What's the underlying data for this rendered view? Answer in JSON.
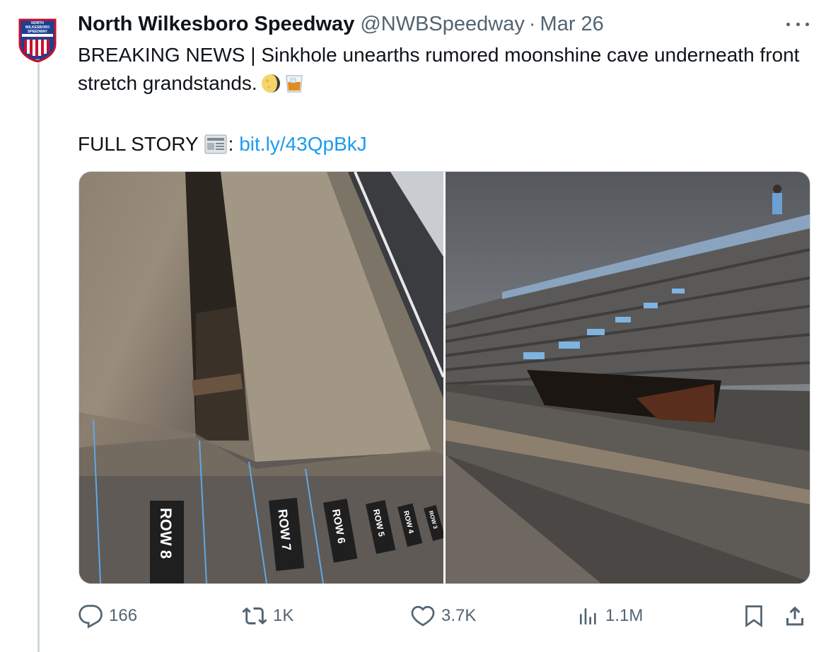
{
  "tweet": {
    "author_name": "North Wilkesboro Speedway",
    "handle": "@NWBSpeedway",
    "separator": "·",
    "date": "Mar 26",
    "text_line1": "BREAKING NEWS | Sinkhole unearths rumored moonshine cave underneath front stretch grandstands.",
    "story_label": "FULL STORY",
    "story_colon": ":",
    "link_text": "bit.ly/43QpBkJ",
    "logo": {
      "line1": "NORTH",
      "line2": "WILKESBORO",
      "line3": "SPEEDWAY",
      "line4": "NORTH CAROLINA",
      "line5": "USA"
    },
    "icons": {
      "emoji1": "moon-icon",
      "emoji2": "glass-icon",
      "emoji3": "newspaper-icon"
    }
  },
  "photos": {
    "left_rows": [
      "ROW 8",
      "ROW 7",
      "ROW 6",
      "ROW 5",
      "ROW 4",
      "ROW 3"
    ]
  },
  "actions": {
    "replies": "166",
    "reposts": "1K",
    "likes": "3.7K",
    "views": "1.1M"
  },
  "colors": {
    "link": "#1d9bf0",
    "muted": "#536471",
    "text": "#0f1419",
    "brand_red": "#c8102e",
    "brand_blue": "#1c3f94"
  }
}
